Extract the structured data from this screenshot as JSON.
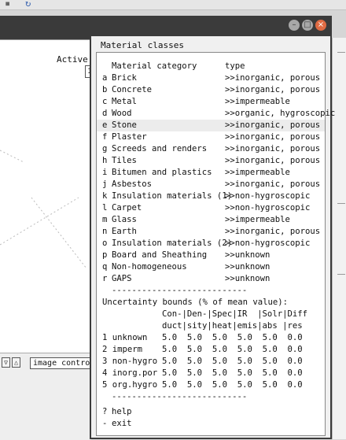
{
  "background": {
    "active_label": "Active",
    "active_box": "1",
    "image_control_label": "image contro",
    "arrow_left": "▽",
    "arrow_right": "△"
  },
  "window": {
    "title": "Material classes",
    "controls": {
      "minimize": "–",
      "maximize": "□",
      "close": "×"
    }
  },
  "header": {
    "category": "Material category",
    "type": "type"
  },
  "materials": [
    {
      "key": "a",
      "category": "Brick",
      "type": ">>inorganic, porous"
    },
    {
      "key": "b",
      "category": "Concrete",
      "type": ">>inorganic, porous"
    },
    {
      "key": "c",
      "category": "Metal",
      "type": ">>impermeable"
    },
    {
      "key": "d",
      "category": "Wood",
      "type": ">>organic, hygroscopic"
    },
    {
      "key": "e",
      "category": "Stone",
      "type": ">>inorganic, porous"
    },
    {
      "key": "f",
      "category": "Plaster",
      "type": ">>inorganic, porous"
    },
    {
      "key": "g",
      "category": "Screeds and renders",
      "type": ">>inorganic, porous"
    },
    {
      "key": "h",
      "category": "Tiles",
      "type": ">>inorganic, porous"
    },
    {
      "key": "i",
      "category": "Bitumen and plastics",
      "type": ">>impermeable"
    },
    {
      "key": "j",
      "category": "Asbestos",
      "type": ">>inorganic, porous"
    },
    {
      "key": "k",
      "category": "Insulation materials (1)",
      "type": ">>non-hygroscopic"
    },
    {
      "key": "l",
      "category": "Carpet",
      "type": ">>non-hygroscopic"
    },
    {
      "key": "m",
      "category": "Glass",
      "type": ">>impermeable"
    },
    {
      "key": "n",
      "category": "Earth",
      "type": ">>inorganic, porous"
    },
    {
      "key": "o",
      "category": "Insulation materials (2)",
      "type": ">>non-hygroscopic"
    },
    {
      "key": "p",
      "category": "Board and Sheathing",
      "type": ">>unknown"
    },
    {
      "key": "q",
      "category": "Non-homogeneous",
      "type": ">>unknown"
    },
    {
      "key": "r",
      "category": "GAPS",
      "type": ">>unknown"
    }
  ],
  "separator": "---------------------------",
  "uncertainty": {
    "title": "Uncertainty bounds (% of mean value):",
    "header1": "Con-|Den-|Spec|IR  |Solr|Diff",
    "header2": "duct|sity|heat|emis|abs |res",
    "rows": [
      {
        "label": "1 unknown",
        "values": [
          "5.0",
          "5.0",
          "5.0",
          "5.0",
          "5.0",
          "0.0"
        ]
      },
      {
        "label": "2 imperm",
        "values": [
          "5.0",
          "5.0",
          "5.0",
          "5.0",
          "5.0",
          "0.0"
        ]
      },
      {
        "label": "3 non-hygro",
        "values": [
          "5.0",
          "5.0",
          "5.0",
          "5.0",
          "5.0",
          "0.0"
        ]
      },
      {
        "label": "4 inorg.por",
        "values": [
          "5.0",
          "5.0",
          "5.0",
          "5.0",
          "5.0",
          "0.0"
        ]
      },
      {
        "label": "5 org.hygro",
        "values": [
          "5.0",
          "5.0",
          "5.0",
          "5.0",
          "5.0",
          "0.0"
        ]
      }
    ]
  },
  "actions": [
    {
      "key": "?",
      "label": "help"
    },
    {
      "key": "-",
      "label": "exit"
    }
  ],
  "colors": {
    "close_button": "#e06b43",
    "window_frame": "#3b3b3b",
    "highlight_row": "#ececec"
  }
}
